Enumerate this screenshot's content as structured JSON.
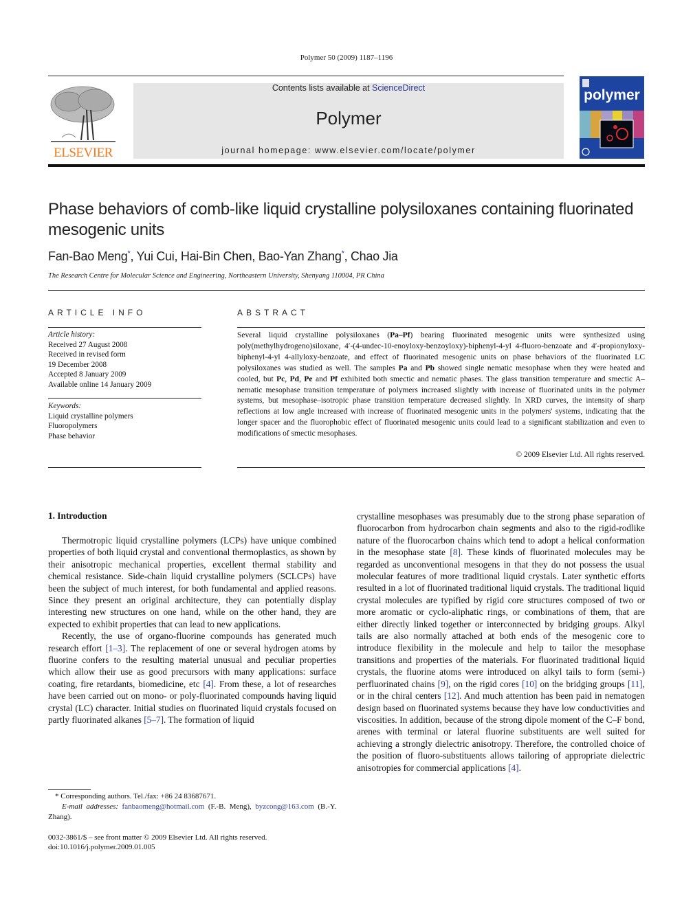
{
  "header": {
    "journal_ref": "Polymer 50 (2009) 1187–1196",
    "contents_prefix": "Contents lists available at ",
    "contents_link": "ScienceDirect",
    "journal_title": "Polymer",
    "homepage": "journal homepage: www.elsevier.com/locate/polymer",
    "publisher_logo": "ELSEVIER",
    "cover_title": "polymer",
    "colors": {
      "elsevier_orange": "#f07b1a",
      "cover_blue": "#1d44a0",
      "link_blue": "#2a3a8f",
      "header_gray": "#e6e6e6"
    }
  },
  "article": {
    "title": "Phase behaviors of comb-like liquid crystalline polysiloxanes containing fluorinated mesogenic units",
    "authors": [
      {
        "name": "Fan-Bao Meng",
        "mark": "*"
      },
      {
        "name": "Yui Cui",
        "mark": ""
      },
      {
        "name": "Hai-Bin Chen",
        "mark": ""
      },
      {
        "name": "Bao-Yan Zhang",
        "mark": "*"
      },
      {
        "name": "Chao Jia",
        "mark": ""
      }
    ],
    "affiliation": "The Research Centre for Molecular Science and Engineering, Northeastern University, Shenyang 110004, PR China"
  },
  "article_info": {
    "heading": "ARTICLE INFO",
    "history_label": "Article history:",
    "history": [
      "Received 27 August 2008",
      "Received in revised form",
      "19 December 2008",
      "Accepted 8 January 2009",
      "Available online 14 January 2009"
    ],
    "keywords_label": "Keywords:",
    "keywords": [
      "Liquid crystalline polymers",
      "Fluoropolymers",
      "Phase behavior"
    ]
  },
  "abstract": {
    "heading": "ABSTRACT",
    "segments": [
      {
        "t": "Several liquid crystalline polysiloxanes ("
      },
      {
        "t": "Pa–Pf",
        "b": true
      },
      {
        "t": ") bearing fluorinated mesogenic units were synthesized using poly(methylhydrogeno)siloxane, 4′-(4-undec-10-enoyloxy-benzoyloxy)-biphenyl-4-yl 4-fluoro-benzoate and 4′-propionyloxy-biphenyl-4-yl 4-allyloxy-benzoate, and effect of fluorinated mesogenic units on phase behaviors of the fluorinated LC polysiloxanes was studied as well. The samples "
      },
      {
        "t": "Pa",
        "b": true
      },
      {
        "t": " and "
      },
      {
        "t": "Pb",
        "b": true
      },
      {
        "t": " showed single nematic mesophase when they were heated and cooled, but "
      },
      {
        "t": "Pc",
        "b": true
      },
      {
        "t": ", "
      },
      {
        "t": "Pd",
        "b": true
      },
      {
        "t": ", "
      },
      {
        "t": "Pe",
        "b": true
      },
      {
        "t": " and "
      },
      {
        "t": "Pf",
        "b": true
      },
      {
        "t": " exhibited both smectic and nematic phases. The glass transition temperature and smectic A–nematic mesophase transition temperature of polymers increased slightly with increase of fluorinated units in the polymer systems, but mesophase–isotropic phase transition temperature decreased slightly. In XRD curves, the intensity of sharp reflections at low angle increased with increase of fluorinated mesogenic units in the polymers' systems, indicating that the longer spacer and the fluorophobic effect of fluorinated mesogenic units could lead to a significant stabilization and even to modifications of smectic mesophases."
      }
    ],
    "copyright": "© 2009 Elsevier Ltd. All rights reserved."
  },
  "body": {
    "section_heading": "1.  Introduction",
    "col1_paragraphs": [
      [
        {
          "t": "Thermotropic liquid crystalline polymers (LCPs) have unique combined properties of both liquid crystal and conventional thermoplastics, as shown by their anisotropic mechanical properties, excellent thermal stability and chemical resistance. Side-chain liquid crystalline polymers (SCLCPs) have been the subject of much interest, for both fundamental and applied reasons. Since they present an original architecture, they can potentially display interesting new structures on one hand, while on the other hand, they are expected to exhibit properties that can lead to new applications."
        }
      ],
      [
        {
          "t": "Recently, the use of organo-fluorine compounds has generated much research effort "
        },
        {
          "t": "[1–3]",
          "c": true
        },
        {
          "t": ". The replacement of one or several hydrogen atoms by fluorine confers to the resulting material unusual and peculiar properties which allow their use as good precursors with many applications: surface coating, fire retardants, biomedicine, etc "
        },
        {
          "t": "[4]",
          "c": true
        },
        {
          "t": ". From these, a lot of researches have been carried out on mono- or poly-fluorinated compounds having liquid crystal (LC) character. Initial studies on fluorinated liquid crystals focused on partly fluorinated alkanes "
        },
        {
          "t": "[5–7]",
          "c": true
        },
        {
          "t": ". The formation of liquid"
        }
      ]
    ],
    "col2_paragraphs": [
      [
        {
          "t": "crystalline mesophases was presumably due to the strong phase separation of fluorocarbon from hydrocarbon chain segments and also to the rigid-rodlike nature of the fluorocarbon chains which tend to adopt a helical conformation in the mesophase state "
        },
        {
          "t": "[8]",
          "c": true
        },
        {
          "t": ". These kinds of fluorinated molecules may be regarded as unconventional mesogens in that they do not possess the usual molecular features of more traditional liquid crystals. Later synthetic efforts resulted in a lot of fluorinated traditional liquid crystals. The traditional liquid crystal molecules are typified by rigid core structures composed of two or more aromatic or cyclo-aliphatic rings, or combinations of them, that are either directly linked together or interconnected by bridging groups. Alkyl tails are also normally attached at both ends of the mesogenic core to introduce flexibility in the molecule and help to tailor the mesophase transitions and properties of the materials. For fluorinated traditional liquid crystals, the fluorine atoms were introduced on alkyl tails to form (semi-) perfluorinated chains "
        },
        {
          "t": "[9]",
          "c": true
        },
        {
          "t": ", on the rigid cores "
        },
        {
          "t": "[10]",
          "c": true
        },
        {
          "t": " on the bridging groups "
        },
        {
          "t": "[11]",
          "c": true
        },
        {
          "t": ", or in the chiral centers "
        },
        {
          "t": "[12]",
          "c": true
        },
        {
          "t": ". And much attention has been paid in nematogen design based on fluorinated systems because they have low conductivities and viscosities. In addition, because of the strong dipole moment of the C–F bond, arenes with terminal or lateral fluorine substituents are well suited for achieving a strongly dielectric anisotropy. Therefore, the controlled choice of the position of fluoro-substituents allows tailoring of appropriate dielectric anisotropies for commercial applications "
        },
        {
          "t": "[4]",
          "c": true
        },
        {
          "t": "."
        }
      ]
    ]
  },
  "footnote": {
    "mark": "*",
    "corresponding": "Corresponding authors. Tel./fax: +86 24 83687671.",
    "email_label": "E-mail addresses:",
    "email1": "fanbaomeng@hotmail.com",
    "email1_owner": "(F.-B. Meng),",
    "email2": "byzcong@163.com",
    "email2_owner": "(B.-Y. Zhang)."
  },
  "front_matter": {
    "issn_line": "0032-3861/$ – see front matter © 2009 Elsevier Ltd. All rights reserved.",
    "doi": "doi:10.1016/j.polymer.2009.01.005"
  }
}
